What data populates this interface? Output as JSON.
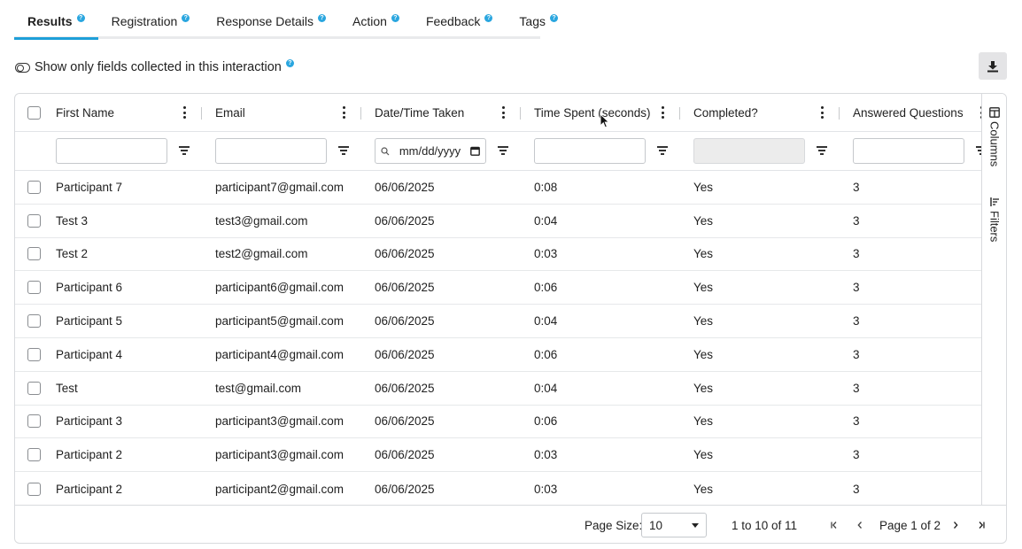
{
  "tabs": [
    {
      "label": "Results",
      "active": true
    },
    {
      "label": "Registration",
      "active": false
    },
    {
      "label": "Response Details",
      "active": false
    },
    {
      "label": "Action",
      "active": false
    },
    {
      "label": "Feedback",
      "active": false
    },
    {
      "label": "Tags",
      "active": false
    }
  ],
  "toggle": {
    "label": "Show only fields collected in this interaction",
    "on": false
  },
  "toolbar": {
    "download_icon": "download-icon"
  },
  "grid": {
    "columns": [
      {
        "label": "First Name"
      },
      {
        "label": "Email"
      },
      {
        "label": "Date/Time Taken"
      },
      {
        "label": "Time Spent (seconds)"
      },
      {
        "label": "Completed?"
      },
      {
        "label": "Answered Questions"
      }
    ],
    "date_filter_placeholder": "mm/dd/yyyy",
    "rows": [
      {
        "first_name": "Participant 7",
        "email": "participant7@gmail.com",
        "date": "06/06/2025",
        "time_spent": "0:08",
        "completed": "Yes",
        "answered": "3"
      },
      {
        "first_name": "Test 3",
        "email": "test3@gmail.com",
        "date": "06/06/2025",
        "time_spent": "0:04",
        "completed": "Yes",
        "answered": "3"
      },
      {
        "first_name": "Test 2",
        "email": "test2@gmail.com",
        "date": "06/06/2025",
        "time_spent": "0:03",
        "completed": "Yes",
        "answered": "3"
      },
      {
        "first_name": "Participant 6",
        "email": "participant6@gmail.com",
        "date": "06/06/2025",
        "time_spent": "0:06",
        "completed": "Yes",
        "answered": "3"
      },
      {
        "first_name": "Participant 5",
        "email": "participant5@gmail.com",
        "date": "06/06/2025",
        "time_spent": "0:04",
        "completed": "Yes",
        "answered": "3"
      },
      {
        "first_name": "Participant 4",
        "email": "participant4@gmail.com",
        "date": "06/06/2025",
        "time_spent": "0:06",
        "completed": "Yes",
        "answered": "3"
      },
      {
        "first_name": "Test",
        "email": "test@gmail.com",
        "date": "06/06/2025",
        "time_spent": "0:04",
        "completed": "Yes",
        "answered": "3"
      },
      {
        "first_name": "Participant 3",
        "email": "participant3@gmail.com",
        "date": "06/06/2025",
        "time_spent": "0:06",
        "completed": "Yes",
        "answered": "3"
      },
      {
        "first_name": "Participant 2",
        "email": "participant3@gmail.com",
        "date": "06/06/2025",
        "time_spent": "0:03",
        "completed": "Yes",
        "answered": "3"
      },
      {
        "first_name": "Participant 2",
        "email": "participant2@gmail.com",
        "date": "06/06/2025",
        "time_spent": "0:03",
        "completed": "Yes",
        "answered": "3"
      }
    ]
  },
  "side_panel": {
    "columns_label": "Columns",
    "filters_label": "Filters"
  },
  "pagination": {
    "page_size_label": "Page Size:",
    "page_size_value": "10",
    "range_text": "1 to 10 of 11",
    "page_text": "Page 1 of 2"
  }
}
